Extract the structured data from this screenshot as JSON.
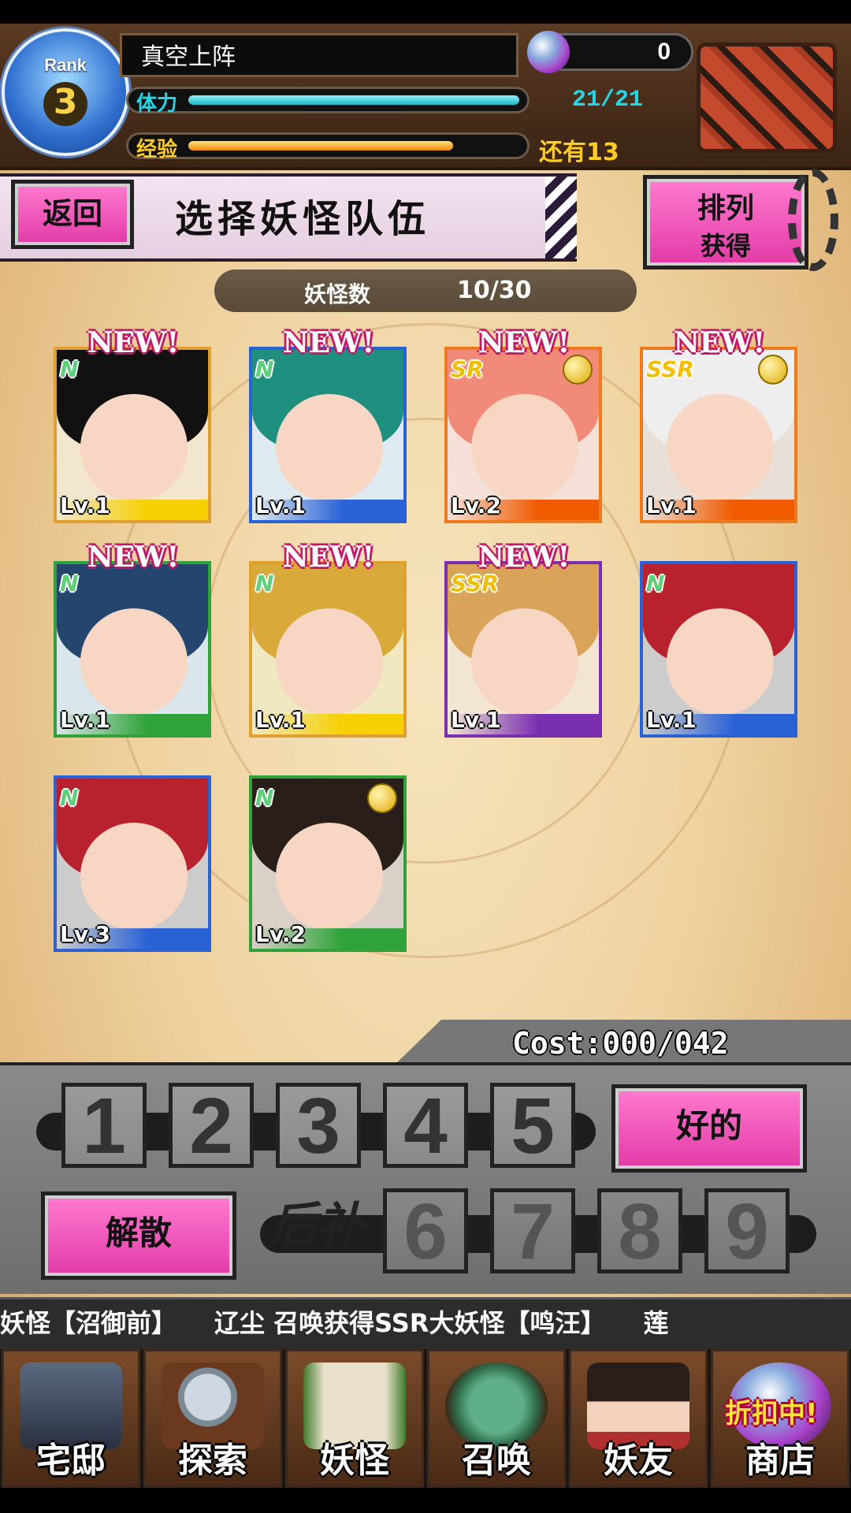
{
  "player": {
    "rank_label": "Rank",
    "rank": "3",
    "name": "真空上阵",
    "gems": "0",
    "stamina_label": "体力",
    "stamina": "21/21",
    "stamina_fill": 1.0,
    "exp_label": "经验",
    "exp_remaining": "还有13",
    "exp_fill": 0.8
  },
  "header": {
    "back": "返回",
    "title": "选择妖怪队伍",
    "sort_line1": "排列",
    "sort_line2": "获得"
  },
  "count": {
    "label": "妖怪数",
    "value": "10/30"
  },
  "new_tag": "NEW!",
  "cards": [
    {
      "level": "Lv.1",
      "rarity": "N",
      "is_new": true,
      "medal": false,
      "frame": "#e0a030",
      "band": "#f6d000",
      "hair": "#111111",
      "bg": "#f2e6cf"
    },
    {
      "level": "Lv.1",
      "rarity": "N",
      "is_new": true,
      "medal": false,
      "frame": "#2a62d6",
      "band": "#2a62d6",
      "hair": "#1f8f80",
      "bg": "#dfeaf0"
    },
    {
      "level": "Lv.2",
      "rarity": "SR",
      "is_new": true,
      "medal": true,
      "frame": "#ef7a1e",
      "band": "#f05a00",
      "hair": "#f28a7a",
      "bg": "#f4e0d6"
    },
    {
      "level": "Lv.1",
      "rarity": "SSR",
      "is_new": true,
      "medal": true,
      "frame": "#ef7a1e",
      "band": "#f05a00",
      "hair": "#eeeeee",
      "bg": "#e8e0d8"
    },
    {
      "level": "Lv.1",
      "rarity": "N",
      "is_new": true,
      "medal": false,
      "frame": "#2fa33a",
      "band": "#2fa33a",
      "hair": "#24466e",
      "bg": "#dbe5ec"
    },
    {
      "level": "Lv.1",
      "rarity": "N",
      "is_new": true,
      "medal": false,
      "frame": "#e0a030",
      "band": "#f6d000",
      "hair": "#d9a93a",
      "bg": "#f0e8c0"
    },
    {
      "level": "Lv.1",
      "rarity": "SSR",
      "is_new": true,
      "medal": false,
      "frame": "#7a2fb0",
      "band": "#7a2fb0",
      "hair": "#d9a35a",
      "bg": "#f2e6d2"
    },
    {
      "level": "Lv.1",
      "rarity": "N",
      "is_new": false,
      "medal": false,
      "frame": "#2a62d6",
      "band": "#2a62d6",
      "hair": "#b8222e",
      "bg": "#cccccc"
    },
    {
      "level": "Lv.3",
      "rarity": "N",
      "is_new": false,
      "medal": false,
      "frame": "#2a62d6",
      "band": "#2a62d6",
      "hair": "#b8222e",
      "bg": "#cccccc"
    },
    {
      "level": "Lv.2",
      "rarity": "N",
      "is_new": false,
      "medal": true,
      "frame": "#2fa33a",
      "band": "#2fa33a",
      "hair": "#2a1e1a",
      "bg": "#d9d0c8"
    }
  ],
  "party": {
    "cost": "Cost:000/042",
    "main_slots": [
      "1",
      "2",
      "3",
      "4",
      "5"
    ],
    "reserve_label": "后补",
    "reserve_slots": [
      "6",
      "7",
      "8",
      "9"
    ],
    "ok_button": "好的",
    "disband_button": "解散"
  },
  "ticker": "妖怪【沼御前】　　辽尘 召唤获得SSR大妖怪【鸣汪】　　莲",
  "nav": [
    {
      "label": "宅邸",
      "icon": "mansion-icon"
    },
    {
      "label": "探索",
      "icon": "magnifier-icon"
    },
    {
      "label": "妖怪",
      "icon": "scroll-icon"
    },
    {
      "label": "召唤",
      "icon": "pentagram-icon"
    },
    {
      "label": "妖友",
      "icon": "fox-girl-icon"
    },
    {
      "label": "商店",
      "icon": "shop-orb-icon"
    }
  ],
  "shop_badge": "折扣中!",
  "colors": {
    "accent_pink": "#e23aa6",
    "stamina": "#27d6e6",
    "exp": "#ffcc22"
  }
}
